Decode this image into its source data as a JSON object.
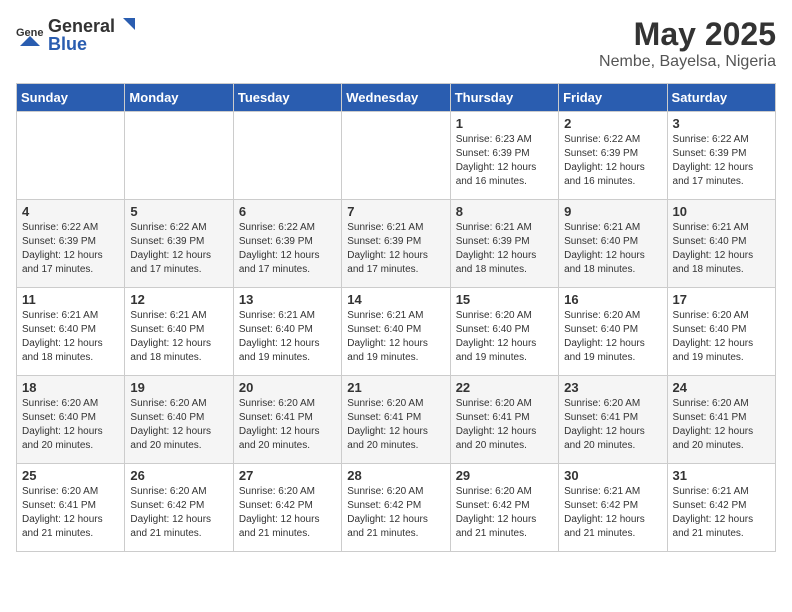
{
  "header": {
    "logo_general": "General",
    "logo_blue": "Blue",
    "month": "May 2025",
    "location": "Nembe, Bayelsa, Nigeria"
  },
  "weekdays": [
    "Sunday",
    "Monday",
    "Tuesday",
    "Wednesday",
    "Thursday",
    "Friday",
    "Saturday"
  ],
  "weeks": [
    [
      {
        "num": "",
        "info": ""
      },
      {
        "num": "",
        "info": ""
      },
      {
        "num": "",
        "info": ""
      },
      {
        "num": "",
        "info": ""
      },
      {
        "num": "1",
        "info": "Sunrise: 6:23 AM\nSunset: 6:39 PM\nDaylight: 12 hours\nand 16 minutes."
      },
      {
        "num": "2",
        "info": "Sunrise: 6:22 AM\nSunset: 6:39 PM\nDaylight: 12 hours\nand 16 minutes."
      },
      {
        "num": "3",
        "info": "Sunrise: 6:22 AM\nSunset: 6:39 PM\nDaylight: 12 hours\nand 17 minutes."
      }
    ],
    [
      {
        "num": "4",
        "info": "Sunrise: 6:22 AM\nSunset: 6:39 PM\nDaylight: 12 hours\nand 17 minutes."
      },
      {
        "num": "5",
        "info": "Sunrise: 6:22 AM\nSunset: 6:39 PM\nDaylight: 12 hours\nand 17 minutes."
      },
      {
        "num": "6",
        "info": "Sunrise: 6:22 AM\nSunset: 6:39 PM\nDaylight: 12 hours\nand 17 minutes."
      },
      {
        "num": "7",
        "info": "Sunrise: 6:21 AM\nSunset: 6:39 PM\nDaylight: 12 hours\nand 17 minutes."
      },
      {
        "num": "8",
        "info": "Sunrise: 6:21 AM\nSunset: 6:39 PM\nDaylight: 12 hours\nand 18 minutes."
      },
      {
        "num": "9",
        "info": "Sunrise: 6:21 AM\nSunset: 6:40 PM\nDaylight: 12 hours\nand 18 minutes."
      },
      {
        "num": "10",
        "info": "Sunrise: 6:21 AM\nSunset: 6:40 PM\nDaylight: 12 hours\nand 18 minutes."
      }
    ],
    [
      {
        "num": "11",
        "info": "Sunrise: 6:21 AM\nSunset: 6:40 PM\nDaylight: 12 hours\nand 18 minutes."
      },
      {
        "num": "12",
        "info": "Sunrise: 6:21 AM\nSunset: 6:40 PM\nDaylight: 12 hours\nand 18 minutes."
      },
      {
        "num": "13",
        "info": "Sunrise: 6:21 AM\nSunset: 6:40 PM\nDaylight: 12 hours\nand 19 minutes."
      },
      {
        "num": "14",
        "info": "Sunrise: 6:21 AM\nSunset: 6:40 PM\nDaylight: 12 hours\nand 19 minutes."
      },
      {
        "num": "15",
        "info": "Sunrise: 6:20 AM\nSunset: 6:40 PM\nDaylight: 12 hours\nand 19 minutes."
      },
      {
        "num": "16",
        "info": "Sunrise: 6:20 AM\nSunset: 6:40 PM\nDaylight: 12 hours\nand 19 minutes."
      },
      {
        "num": "17",
        "info": "Sunrise: 6:20 AM\nSunset: 6:40 PM\nDaylight: 12 hours\nand 19 minutes."
      }
    ],
    [
      {
        "num": "18",
        "info": "Sunrise: 6:20 AM\nSunset: 6:40 PM\nDaylight: 12 hours\nand 20 minutes."
      },
      {
        "num": "19",
        "info": "Sunrise: 6:20 AM\nSunset: 6:40 PM\nDaylight: 12 hours\nand 20 minutes."
      },
      {
        "num": "20",
        "info": "Sunrise: 6:20 AM\nSunset: 6:41 PM\nDaylight: 12 hours\nand 20 minutes."
      },
      {
        "num": "21",
        "info": "Sunrise: 6:20 AM\nSunset: 6:41 PM\nDaylight: 12 hours\nand 20 minutes."
      },
      {
        "num": "22",
        "info": "Sunrise: 6:20 AM\nSunset: 6:41 PM\nDaylight: 12 hours\nand 20 minutes."
      },
      {
        "num": "23",
        "info": "Sunrise: 6:20 AM\nSunset: 6:41 PM\nDaylight: 12 hours\nand 20 minutes."
      },
      {
        "num": "24",
        "info": "Sunrise: 6:20 AM\nSunset: 6:41 PM\nDaylight: 12 hours\nand 20 minutes."
      }
    ],
    [
      {
        "num": "25",
        "info": "Sunrise: 6:20 AM\nSunset: 6:41 PM\nDaylight: 12 hours\nand 21 minutes."
      },
      {
        "num": "26",
        "info": "Sunrise: 6:20 AM\nSunset: 6:42 PM\nDaylight: 12 hours\nand 21 minutes."
      },
      {
        "num": "27",
        "info": "Sunrise: 6:20 AM\nSunset: 6:42 PM\nDaylight: 12 hours\nand 21 minutes."
      },
      {
        "num": "28",
        "info": "Sunrise: 6:20 AM\nSunset: 6:42 PM\nDaylight: 12 hours\nand 21 minutes."
      },
      {
        "num": "29",
        "info": "Sunrise: 6:20 AM\nSunset: 6:42 PM\nDaylight: 12 hours\nand 21 minutes."
      },
      {
        "num": "30",
        "info": "Sunrise: 6:21 AM\nSunset: 6:42 PM\nDaylight: 12 hours\nand 21 minutes."
      },
      {
        "num": "31",
        "info": "Sunrise: 6:21 AM\nSunset: 6:42 PM\nDaylight: 12 hours\nand 21 minutes."
      }
    ]
  ]
}
